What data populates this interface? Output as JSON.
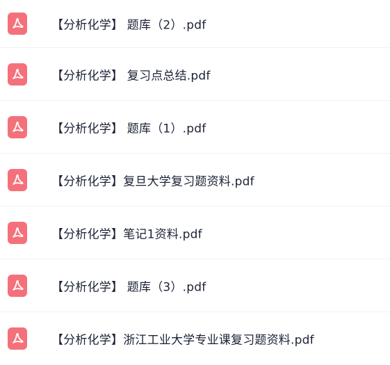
{
  "files": [
    {
      "name": "【分析化学】 题库（2）.pdf",
      "icon": "pdf-file-icon"
    },
    {
      "name": "【分析化学】 复习点总结.pdf",
      "icon": "pdf-file-icon"
    },
    {
      "name": "【分析化学】 题库（1）.pdf",
      "icon": "pdf-file-icon"
    },
    {
      "name": "【分析化学】复旦大学复习题资料.pdf",
      "icon": "pdf-file-icon"
    },
    {
      "name": "【分析化学】笔记1资料.pdf",
      "icon": "pdf-file-icon"
    },
    {
      "name": "【分析化学】 题库（3）.pdf",
      "icon": "pdf-file-icon"
    },
    {
      "name": "【分析化学】浙江工业大学专业课复习题资料.pdf",
      "icon": "pdf-file-icon"
    }
  ],
  "colors": {
    "icon_background": "#f4717b",
    "text": "#1c2236",
    "divider": "#f2f2f4"
  }
}
